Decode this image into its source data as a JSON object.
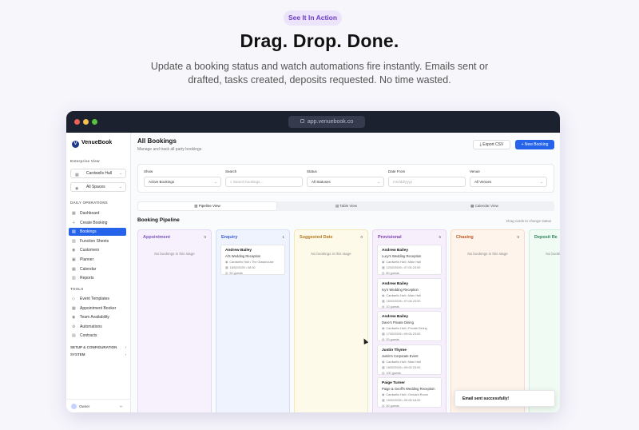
{
  "hero": {
    "pill": "See It In Action",
    "title": "Drag. Drop. Done.",
    "subtitle": "Update a booking status and watch automations fire instantly. Emails sent or drafted, tasks created, deposits requested. No time wasted."
  },
  "browser": {
    "url": "app.venuebook.co"
  },
  "sidebar": {
    "brand": "VenueBook",
    "enterprise_label": "Enterprise View",
    "venue_select": "Cardwells Hall",
    "space_select": "All Spaces",
    "daily_label": "DAILY OPERATIONS",
    "daily_items": [
      "Dashboard",
      "Create Booking",
      "Bookings",
      "Function Sheets",
      "Customers",
      "Planner",
      "Calendar",
      "Reports"
    ],
    "tools_label": "TOOLS",
    "tools_items": [
      "Event Templates",
      "Appointment Booker",
      "Team Availability",
      "Automations",
      "Contracts"
    ],
    "setup_label": "SETUP & CONFIGURATION",
    "system_label": "SYSTEM",
    "user": "Owner"
  },
  "header": {
    "title": "All Bookings",
    "subtitle": "Manage and track all party bookings",
    "export_label": "Export CSV",
    "new_label": "+ New Booking"
  },
  "filters": {
    "show_label": "Show",
    "show_value": "Active Bookings",
    "search_label": "Search",
    "search_placeholder": "Search bookings...",
    "status_label": "Status",
    "status_value": "All Statuses",
    "date_label": "Date From",
    "date_placeholder": "mm/dd/yyyy",
    "venue_label": "Venue",
    "venue_value": "All Venues"
  },
  "views": [
    "Pipeline View",
    "Table View",
    "Calendar View"
  ],
  "pipeline": {
    "title": "Booking Pipeline",
    "hint": "Drag cards to change status",
    "empty_text": "No bookings in this stage",
    "columns": [
      {
        "name": "Appointment",
        "count": "0",
        "color": "#7e57c2",
        "bg": "#f6f1fd",
        "border": "#e4d8f7",
        "cards": []
      },
      {
        "name": "Enquiry",
        "count": "1",
        "color": "#3b5bdb",
        "bg": "#eef3fd",
        "border": "#d4e0f8",
        "cards": [
          {
            "name": "Andrew Bailey",
            "event": "Al's Wedding Reception",
            "venue": "Cardwells Hall • The Glasshouse",
            "date": "18/02/2026 • 08:30",
            "guests": "50 guests"
          }
        ]
      },
      {
        "name": "Suggested Date",
        "count": "0",
        "color": "#b7791f",
        "bg": "#fefaea",
        "border": "#f4e7b8",
        "cards": []
      },
      {
        "name": "Provisional",
        "count": "5",
        "color": "#7b3fb5",
        "bg": "#f7f0fc",
        "border": "#e6d5f5",
        "cards": [
          {
            "name": "Andrew Bailey",
            "event": "Lucy's Wedding Reception",
            "venue": "Cardwells Hall • Main Hall",
            "date": "12/02/2026 • 07:00-23:00",
            "guests": "80 guests"
          },
          {
            "name": "Andrew Bailey",
            "event": "Ivy's Wedding Reception",
            "venue": "Cardwells Hall • Main Hall",
            "date": "16/02/2026 • 07:00-23:00",
            "guests": "10 guests"
          },
          {
            "name": "Andrew Bailey",
            "event": "Dave's Private Dining",
            "venue": "Cardwells Hall • Private Dining",
            "date": "17/02/2026 • 09:00-23:00",
            "guests": "20 guests"
          },
          {
            "name": "Justin Thyme",
            "event": "Justin's Corporate Event",
            "venue": "Cardwells Hall • Main Hall",
            "date": "18/02/2026 • 09:00-23:00",
            "guests": "100 guests"
          },
          {
            "name": "Paige Turner",
            "event": "Paige & Geoff's Wedding Reception",
            "venue": "Cardwells Hall • Orchard Room",
            "date": "19/02/2026 • 09:00-18:00",
            "guests": "50 guests"
          }
        ]
      },
      {
        "name": "Chasing",
        "count": "0",
        "color": "#c05621",
        "bg": "#fef4ec",
        "border": "#f6dcc6",
        "cards": []
      },
      {
        "name": "Deposit Re",
        "count": "",
        "color": "#2f855a",
        "bg": "#effbf3",
        "border": "#cfeedb",
        "cards": []
      }
    ]
  },
  "toast": "Email sent successfully!",
  "icons": [
    "chevron-down-icon",
    "lock-icon",
    "building-icon",
    "map-pin-icon",
    "search-icon",
    "calendar-icon",
    "users-icon",
    "download-icon"
  ]
}
